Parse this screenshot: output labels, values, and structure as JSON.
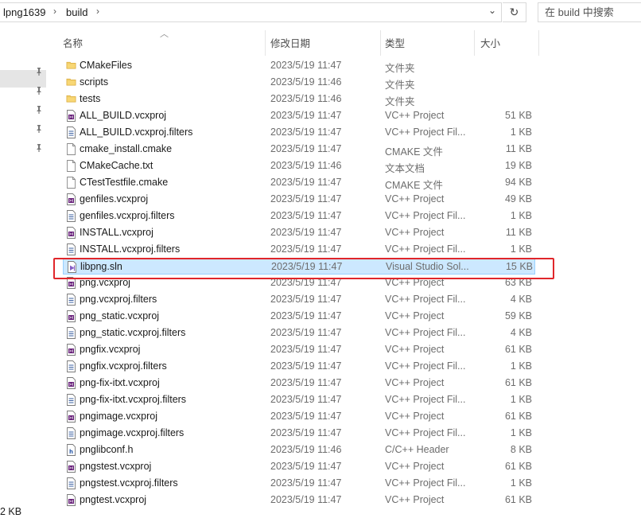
{
  "address_bar": {
    "crumbs": [
      "lpng1639",
      "build"
    ],
    "search_placeholder": "在 build 中搜索"
  },
  "columns": {
    "name": "名称",
    "date": "修改日期",
    "type": "类型",
    "size": "大小"
  },
  "files": [
    {
      "name": "CMakeFiles",
      "date": "2023/5/19 11:47",
      "type": "文件夹",
      "size": "",
      "icon": "folder-icon"
    },
    {
      "name": "scripts",
      "date": "2023/5/19 11:46",
      "type": "文件夹",
      "size": "",
      "icon": "folder-icon"
    },
    {
      "name": "tests",
      "date": "2023/5/19 11:46",
      "type": "文件夹",
      "size": "",
      "icon": "folder-icon"
    },
    {
      "name": "ALL_BUILD.vcxproj",
      "date": "2023/5/19 11:47",
      "type": "VC++ Project",
      "size": "51 KB",
      "icon": "vcxproj-icon"
    },
    {
      "name": "ALL_BUILD.vcxproj.filters",
      "date": "2023/5/19 11:47",
      "type": "VC++ Project Fil...",
      "size": "1 KB",
      "icon": "filters-icon"
    },
    {
      "name": "cmake_install.cmake",
      "date": "2023/5/19 11:47",
      "type": "CMAKE 文件",
      "size": "11 KB",
      "icon": "file-icon"
    },
    {
      "name": "CMakeCache.txt",
      "date": "2023/5/19 11:46",
      "type": "文本文档",
      "size": "19 KB",
      "icon": "file-icon"
    },
    {
      "name": "CTestTestfile.cmake",
      "date": "2023/5/19 11:47",
      "type": "CMAKE 文件",
      "size": "94 KB",
      "icon": "file-icon"
    },
    {
      "name": "genfiles.vcxproj",
      "date": "2023/5/19 11:47",
      "type": "VC++ Project",
      "size": "49 KB",
      "icon": "vcxproj-icon"
    },
    {
      "name": "genfiles.vcxproj.filters",
      "date": "2023/5/19 11:47",
      "type": "VC++ Project Fil...",
      "size": "1 KB",
      "icon": "filters-icon"
    },
    {
      "name": "INSTALL.vcxproj",
      "date": "2023/5/19 11:47",
      "type": "VC++ Project",
      "size": "11 KB",
      "icon": "vcxproj-icon"
    },
    {
      "name": "INSTALL.vcxproj.filters",
      "date": "2023/5/19 11:47",
      "type": "VC++ Project Fil...",
      "size": "1 KB",
      "icon": "filters-icon"
    },
    {
      "name": "libpng.sln",
      "date": "2023/5/19 11:47",
      "type": "Visual Studio Sol...",
      "size": "15 KB",
      "icon": "sln-icon",
      "selected": true
    },
    {
      "name": "png.vcxproj",
      "date": "2023/5/19 11:47",
      "type": "VC++ Project",
      "size": "63 KB",
      "icon": "vcxproj-icon"
    },
    {
      "name": "png.vcxproj.filters",
      "date": "2023/5/19 11:47",
      "type": "VC++ Project Fil...",
      "size": "4 KB",
      "icon": "filters-icon"
    },
    {
      "name": "png_static.vcxproj",
      "date": "2023/5/19 11:47",
      "type": "VC++ Project",
      "size": "59 KB",
      "icon": "vcxproj-icon"
    },
    {
      "name": "png_static.vcxproj.filters",
      "date": "2023/5/19 11:47",
      "type": "VC++ Project Fil...",
      "size": "4 KB",
      "icon": "filters-icon"
    },
    {
      "name": "pngfix.vcxproj",
      "date": "2023/5/19 11:47",
      "type": "VC++ Project",
      "size": "61 KB",
      "icon": "vcxproj-icon"
    },
    {
      "name": "pngfix.vcxproj.filters",
      "date": "2023/5/19 11:47",
      "type": "VC++ Project Fil...",
      "size": "1 KB",
      "icon": "filters-icon"
    },
    {
      "name": "png-fix-itxt.vcxproj",
      "date": "2023/5/19 11:47",
      "type": "VC++ Project",
      "size": "61 KB",
      "icon": "vcxproj-icon"
    },
    {
      "name": "png-fix-itxt.vcxproj.filters",
      "date": "2023/5/19 11:47",
      "type": "VC++ Project Fil...",
      "size": "1 KB",
      "icon": "filters-icon"
    },
    {
      "name": "pngimage.vcxproj",
      "date": "2023/5/19 11:47",
      "type": "VC++ Project",
      "size": "61 KB",
      "icon": "vcxproj-icon"
    },
    {
      "name": "pngimage.vcxproj.filters",
      "date": "2023/5/19 11:47",
      "type": "VC++ Project Fil...",
      "size": "1 KB",
      "icon": "filters-icon"
    },
    {
      "name": "pnglibconf.h",
      "date": "2023/5/19 11:46",
      "type": "C/C++ Header",
      "size": "8 KB",
      "icon": "header-icon"
    },
    {
      "name": "pngstest.vcxproj",
      "date": "2023/5/19 11:47",
      "type": "VC++ Project",
      "size": "61 KB",
      "icon": "vcxproj-icon"
    },
    {
      "name": "pngstest.vcxproj.filters",
      "date": "2023/5/19 11:47",
      "type": "VC++ Project Fil...",
      "size": "1 KB",
      "icon": "filters-icon"
    },
    {
      "name": "pngtest.vcxproj",
      "date": "2023/5/19 11:47",
      "type": "VC++ Project",
      "size": "61 KB",
      "icon": "vcxproj-icon"
    }
  ],
  "status": {
    "text": "2 KB"
  },
  "colors": {
    "selection_bg": "#cce8ff",
    "selection_border": "#99d1ff",
    "highlight_box": "#e0262b",
    "folder": "#f8d775",
    "vcxproj": "#68217a"
  }
}
